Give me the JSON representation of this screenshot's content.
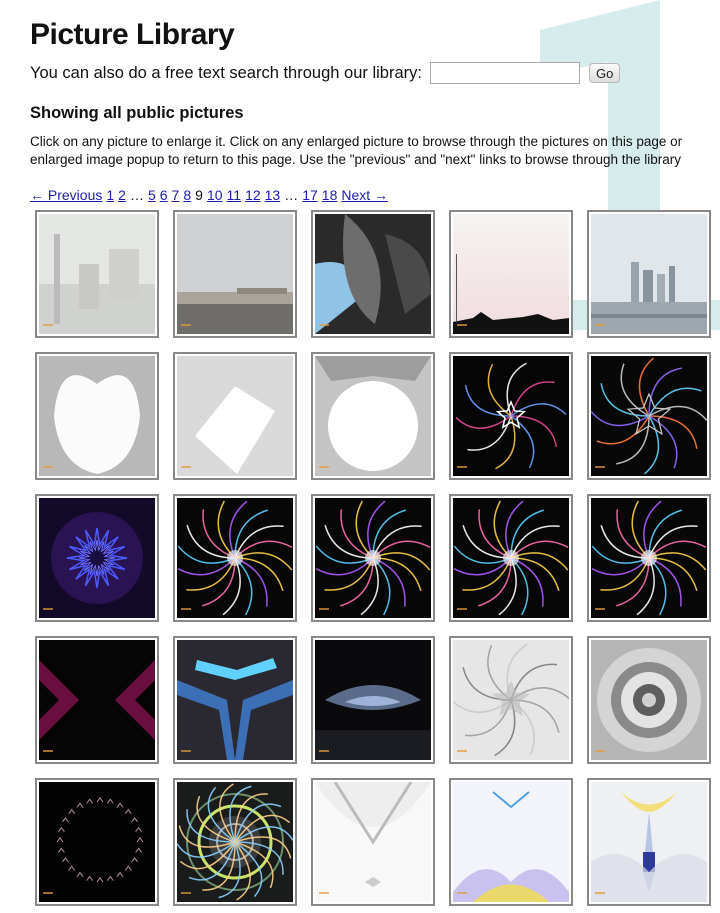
{
  "page": {
    "title": "Picture Library",
    "search_label": "You can also do a free text search through our library:",
    "search_value": "",
    "search_placeholder": "",
    "go_label": "Go",
    "subtitle": "Showing all public pictures",
    "intro_line1": "Click on any picture to enlarge it. Click on any enlarged picture to browse through the pictures on this page or",
    "intro_line2": "enlarged image popup to return to this page. Use the \"previous\" and \"next\" links to browse through the library",
    "watermark": "1"
  },
  "pagination": [
    {
      "label": "← Previous",
      "link": true
    },
    {
      "label": "1",
      "link": true
    },
    {
      "label": "2",
      "link": true
    },
    {
      "label": "…",
      "link": false
    },
    {
      "label": "5",
      "link": true
    },
    {
      "label": "6",
      "link": true
    },
    {
      "label": "7",
      "link": true
    },
    {
      "label": "8",
      "link": true
    },
    {
      "label": "9",
      "link": false
    },
    {
      "label": "10",
      "link": true
    },
    {
      "label": "11",
      "link": true
    },
    {
      "label": "12",
      "link": true
    },
    {
      "label": "13",
      "link": true
    },
    {
      "label": "…",
      "link": false
    },
    {
      "label": "17",
      "link": true
    },
    {
      "label": "18",
      "link": true
    },
    {
      "label": "Next →",
      "link": true
    }
  ],
  "thumbnails": [
    {
      "kind": "foggy-street"
    },
    {
      "kind": "beach"
    },
    {
      "kind": "blurred-abstract"
    },
    {
      "kind": "sunset-skyline"
    },
    {
      "kind": "city-skyline"
    },
    {
      "kind": "white-heart"
    },
    {
      "kind": "white-diamond"
    },
    {
      "kind": "white-circle"
    },
    {
      "kind": "star-kaleidoscope"
    },
    {
      "kind": "dark-kaleidoscope"
    },
    {
      "kind": "purple-mandala"
    },
    {
      "kind": "colorful-mandala"
    },
    {
      "kind": "colorful-mandala"
    },
    {
      "kind": "colorful-mandala"
    },
    {
      "kind": "colorful-mandala"
    },
    {
      "kind": "dark-magenta-chevrons"
    },
    {
      "kind": "blue-structure"
    },
    {
      "kind": "dark-mask"
    },
    {
      "kind": "gray-kaleidoscope"
    },
    {
      "kind": "gray-radial"
    },
    {
      "kind": "dotted-ring"
    },
    {
      "kind": "green-radial"
    },
    {
      "kind": "white-abstract"
    },
    {
      "kind": "pastel-abstract"
    },
    {
      "kind": "pastel-figure"
    }
  ],
  "colors": {
    "link": "#1d1da8",
    "watermark": "#d2e9e9",
    "thumb_border": "#888888"
  }
}
